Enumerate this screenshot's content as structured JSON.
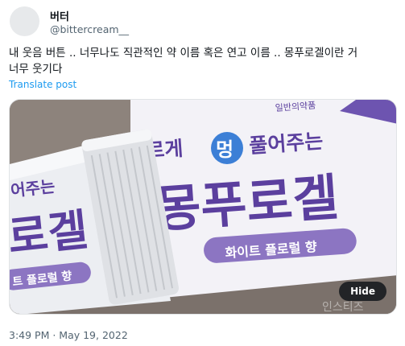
{
  "tweet": {
    "display_name": "버터",
    "handle": "@bittercream__",
    "text_line1": "내 웃음 버튼 .. 너무나도 직관적인 약 이름 혹은 연고 이름 .. 몽푸로겔이란 거",
    "text_line2": "너무 웃기다",
    "translate_label": "Translate post",
    "timestamp": "3:49 PM · May 19, 2022"
  },
  "media": {
    "hide_label": "Hide",
    "package_tag": "일반의약품",
    "slogan_left": "르게",
    "slogan_badge": "멍",
    "slogan_right": "풀어주는",
    "brand_name": "몽푸로겔",
    "subtitle": "화이트 플로럴 향",
    "tube_slogan": "어주는",
    "tube_brand": "로겔",
    "tube_subtitle": "트 플로럴 향",
    "watermark": "인스티즈",
    "colors": {
      "purple": "#5b3f9e",
      "badge_blue": "#3c7fd6",
      "subtitle_pill": "#8c75c2",
      "box_bg": "#f4f3f8"
    }
  }
}
